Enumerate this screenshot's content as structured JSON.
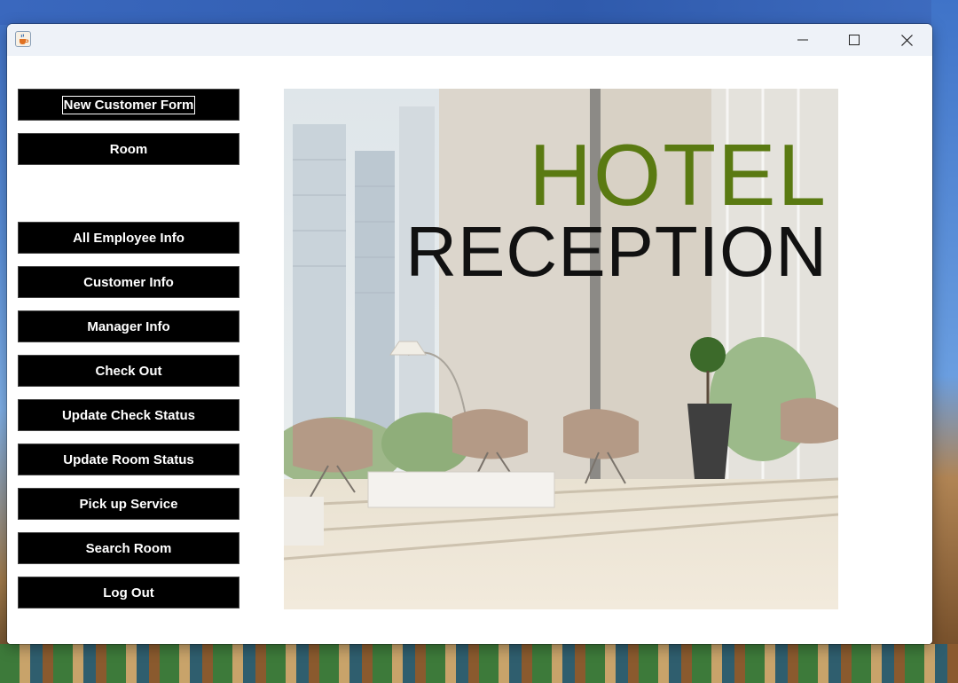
{
  "window": {
    "title": "",
    "controls": {
      "minimize": "minimize-icon",
      "maximize": "maximize-icon",
      "close": "close-icon"
    }
  },
  "menu": {
    "new_customer_form": "New Customer Form",
    "room": "Room",
    "all_employee_info": "All Employee Info",
    "customer_info": "Customer Info",
    "manager_info": "Manager Info",
    "check_out": "Check Out",
    "update_check_status": "Update Check Status",
    "update_room_status": "Update Room Status",
    "pick_up_service": "Pick up Service",
    "search_room": "Search Room",
    "log_out": "Log Out"
  },
  "hero": {
    "line1": "HOTEL",
    "line2": "RECEPTION"
  },
  "colors": {
    "button_bg": "#000000",
    "button_text": "#ffffff",
    "hotel_green": "#5a7a12",
    "reception_black": "#111111"
  }
}
